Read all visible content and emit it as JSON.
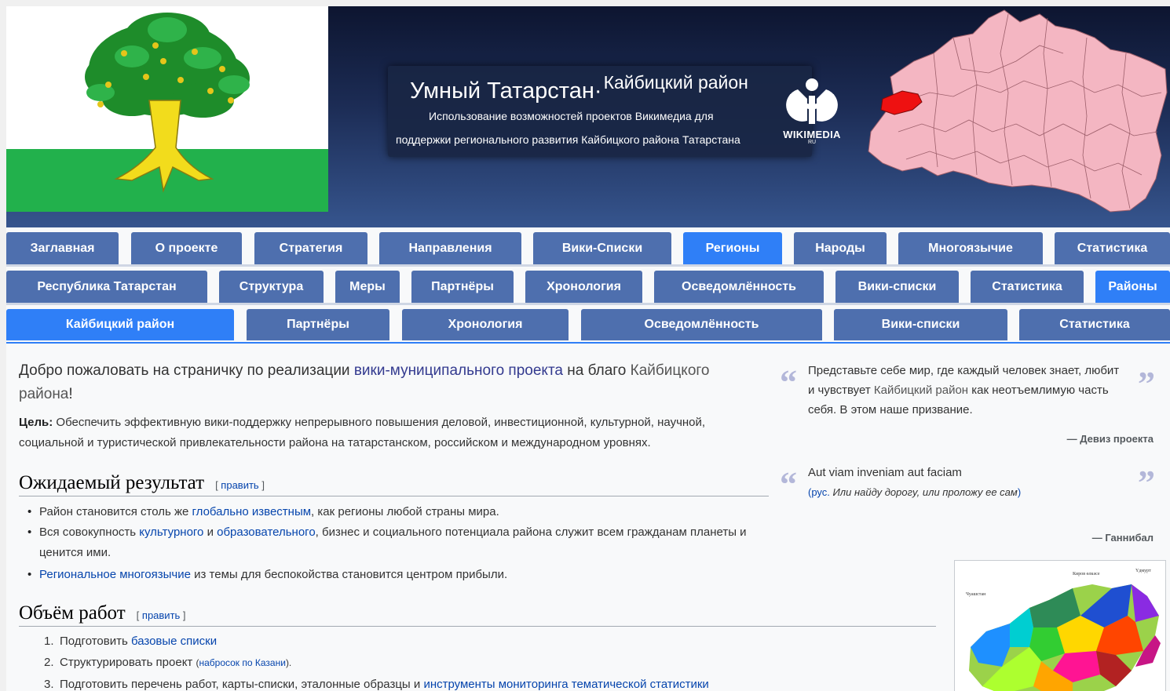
{
  "header": {
    "title_main": "Умный Татарстан",
    "title_region": "Кайбицкий район",
    "subtitle_line1": "Использование возможностей проектов Викимедиа для",
    "subtitle_line2": "поддержки регионального развития Кайбицкого района Татарстана",
    "logo_text": "WIKIMEDIA",
    "logo_sub": "RU"
  },
  "nav": {
    "row1": [
      {
        "label": "Заглавная",
        "active": false
      },
      {
        "label": "О проекте",
        "active": false
      },
      {
        "label": "Стратегия",
        "active": false
      },
      {
        "label": "Направления",
        "active": false
      },
      {
        "label": "Вики-Списки",
        "active": false
      },
      {
        "label": "Регионы",
        "active": true
      },
      {
        "label": "Народы",
        "active": false
      },
      {
        "label": "Многоязычие",
        "active": false
      },
      {
        "label": "Статистика",
        "active": false
      }
    ],
    "row2": [
      {
        "label": "Республика Татарстан",
        "active": false
      },
      {
        "label": "Структура",
        "active": false
      },
      {
        "label": "Меры",
        "active": false
      },
      {
        "label": "Партнёры",
        "active": false
      },
      {
        "label": "Хронология",
        "active": false
      },
      {
        "label": "Осведомлённость",
        "active": false
      },
      {
        "label": "Вики-списки",
        "active": false
      },
      {
        "label": "Статистика",
        "active": false
      },
      {
        "label": "Районы",
        "active": true
      }
    ],
    "row3": [
      {
        "label": "Кайбицкий район",
        "active": true
      },
      {
        "label": "Партнёры",
        "active": false
      },
      {
        "label": "Хронология",
        "active": false
      },
      {
        "label": "Осведомлённость",
        "active": false
      },
      {
        "label": "Вики-списки",
        "active": false
      },
      {
        "label": "Статистика",
        "active": false
      }
    ]
  },
  "content": {
    "welcome_pre": "Добро пожаловать на страничку по реализации ",
    "welcome_link": "вики-муниципального проекта",
    "welcome_mid": " на благо ",
    "welcome_region": "Кайбицкого района",
    "welcome_end": "!",
    "goal_label": "Цель:",
    "goal_text": " Обеспечить эффективную вики-поддержку непрерывного повышения деловой, инвестиционной, культурной, научной, социальной и туристической привлекательности района на татарстанском, российском и международном уровнях.",
    "edit_open": "[ ",
    "edit_label": "править",
    "edit_close": " ]",
    "section1": {
      "title": "Ожидаемый результат",
      "items": [
        {
          "pre": "Район становится столь же ",
          "link": "глобально известным",
          "post": ", как регионы любой страны мира."
        },
        {
          "pre": "Вся совокупность ",
          "link": "культурного",
          "mid": " и ",
          "link2": "образовательного",
          "post": ", бизнес и социального потенциала района служит всем гражданам планеты и ценится ими."
        },
        {
          "pre": "",
          "link": "Региональное многоязычие",
          "post": " из темы для беспокойства становится центром прибыли."
        }
      ]
    },
    "section2": {
      "title": "Объём работ",
      "items": [
        {
          "num": "1.",
          "pre": "Подготовить ",
          "link": "базовые списки",
          "post": ""
        },
        {
          "num": "2.",
          "pre": "Структурировать проект ",
          "small_open": "(",
          "small_link": "набросок по Казани",
          "small_close": ").",
          "post": ""
        },
        {
          "num": "3.",
          "pre": "Подготовить перечень работ, карты-списки, эталонные образцы и ",
          "link": "инструменты мониторинга тематической статистики",
          "post": ""
        }
      ]
    }
  },
  "quotes": [
    {
      "text_pre": "Представьте себе мир, где каждый человек знает, любит и чувствует ",
      "text_link": "Кайбицкий район",
      "text_post": " как неотъемлимую часть себя. В этом наше призвание.",
      "source": "— Девиз проекта"
    },
    {
      "text": "Aut viam inveniam aut faciam",
      "trans_pre": "(рус. ",
      "trans_italic": "Или найду дорогу, или проложу ее сам",
      "trans_post": ")",
      "source": "— Ганнибал"
    }
  ],
  "quote_open": "“",
  "quote_close": "”",
  "colors": {
    "tab": "#4e6fae",
    "tab_active": "#2f7ff7",
    "link": "#0645ad",
    "header_dark": "#0d1530",
    "map_fill": "#f4b6c2",
    "map_highlight": "#ee1111",
    "flag_green": "#22b14c"
  }
}
